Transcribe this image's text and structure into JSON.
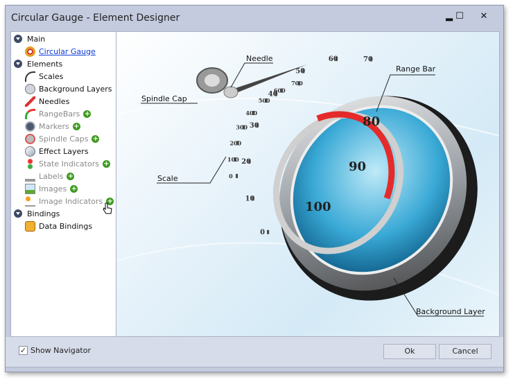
{
  "window": {
    "title": "Circular Gauge - Element Designer",
    "minimize": "▂",
    "maximize": "☐",
    "close": "✕"
  },
  "tree": {
    "groups": [
      {
        "label": "Main"
      },
      {
        "label": "Elements"
      },
      {
        "label": "Bindings"
      }
    ],
    "main_items": [
      {
        "label": "Circular Gauge",
        "icon": "circular-gauge-icon",
        "link": true
      }
    ],
    "element_items": [
      {
        "label": "Scales",
        "icon": "scales-icon",
        "enabled": true,
        "add": false
      },
      {
        "label": "Background Layers",
        "icon": "background-layers-icon",
        "enabled": true,
        "add": false
      },
      {
        "label": "Needles",
        "icon": "needles-icon",
        "enabled": true,
        "add": false
      },
      {
        "label": "RangeBars",
        "icon": "rangebars-icon",
        "enabled": false,
        "add": true
      },
      {
        "label": "Markers",
        "icon": "markers-icon",
        "enabled": false,
        "add": true
      },
      {
        "label": "Spindle Caps",
        "icon": "spindle-caps-icon",
        "enabled": false,
        "add": true
      },
      {
        "label": "Effect Layers",
        "icon": "effect-layers-icon",
        "enabled": true,
        "add": false
      },
      {
        "label": "State Indicators",
        "icon": "state-indicators-icon",
        "enabled": false,
        "add": true
      },
      {
        "label": "Labels",
        "icon": "labels-icon",
        "enabled": false,
        "add": true
      },
      {
        "label": "Images",
        "icon": "images-icon",
        "enabled": false,
        "add": true
      },
      {
        "label": "Image Indicators",
        "icon": "image-indicators-icon",
        "enabled": false,
        "add": true
      }
    ],
    "binding_items": [
      {
        "label": "Data Bindings",
        "icon": "data-bindings-icon"
      }
    ],
    "plus_glyph": "+"
  },
  "preview": {
    "callouts": {
      "needle": "Needle",
      "spindle_cap": "Spindle Cap",
      "scale": "Scale",
      "range_bar": "Range Bar",
      "background_layer": "Background Layer"
    },
    "scale_labels": [
      "0",
      "10",
      "20",
      "30",
      "40",
      "50",
      "60",
      "70",
      "80",
      "90",
      "100"
    ],
    "back_scale_labels": [
      "0",
      "100",
      "200",
      "300",
      "400",
      "500",
      "600",
      "700"
    ],
    "range_color": "#e52a2a"
  },
  "footer": {
    "show_navigator_label": "Show Navigator",
    "show_navigator_checked": true,
    "check_glyph": "✓",
    "ok_label": "Ok",
    "cancel_label": "Cancel"
  }
}
